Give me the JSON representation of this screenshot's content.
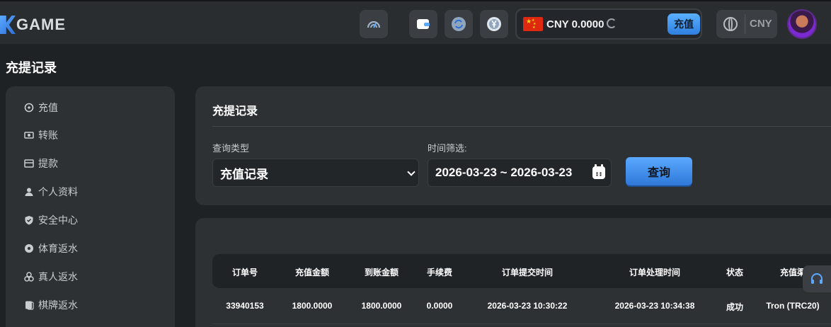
{
  "header": {
    "logo_text": "GAME",
    "balance": "CNY 0.0000",
    "recharge_label": "充值",
    "currency": "CNY",
    "icons": [
      "speedometer-icon",
      "wallet-icon",
      "exchange-icon",
      "yen-coin-icon",
      "globe-icon",
      "avatar"
    ]
  },
  "page": {
    "title": "充提记录"
  },
  "sidebar": {
    "items": [
      {
        "label": "充值",
        "icon": "recharge-icon"
      },
      {
        "label": "转账",
        "icon": "transfer-icon"
      },
      {
        "label": "提款",
        "icon": "withdraw-icon"
      },
      {
        "label": "个人资料",
        "icon": "user-icon"
      },
      {
        "label": "安全中心",
        "icon": "shield-icon"
      },
      {
        "label": "体育返水",
        "icon": "soccer-ball-icon"
      },
      {
        "label": "真人返水",
        "icon": "casino-chips-icon"
      },
      {
        "label": "棋牌返水",
        "icon": "cards-icon"
      }
    ]
  },
  "filter": {
    "title": "充提记录",
    "query_type_label": "查询类型",
    "query_type_value": "充值记录",
    "date_label": "时间筛选:",
    "date_range": "2026-03-23 ~ 2026-03-23",
    "query_button": "查询"
  },
  "table": {
    "columns": [
      "订单号",
      "充值金额",
      "到账金额",
      "手续费",
      "订单提交时间",
      "订单处理时间",
      "状态",
      "充值渠"
    ],
    "rows": [
      [
        "33940153",
        "1800.0000",
        "1800.0000",
        "0.0000",
        "2026-03-23 10:30:22",
        "2026-03-23 10:34:38",
        "成功",
        "Tron (TRC20)"
      ]
    ]
  },
  "colors": {
    "accent": "#3f8ff0",
    "panel": "#2d3134",
    "background": "#1f2224"
  }
}
